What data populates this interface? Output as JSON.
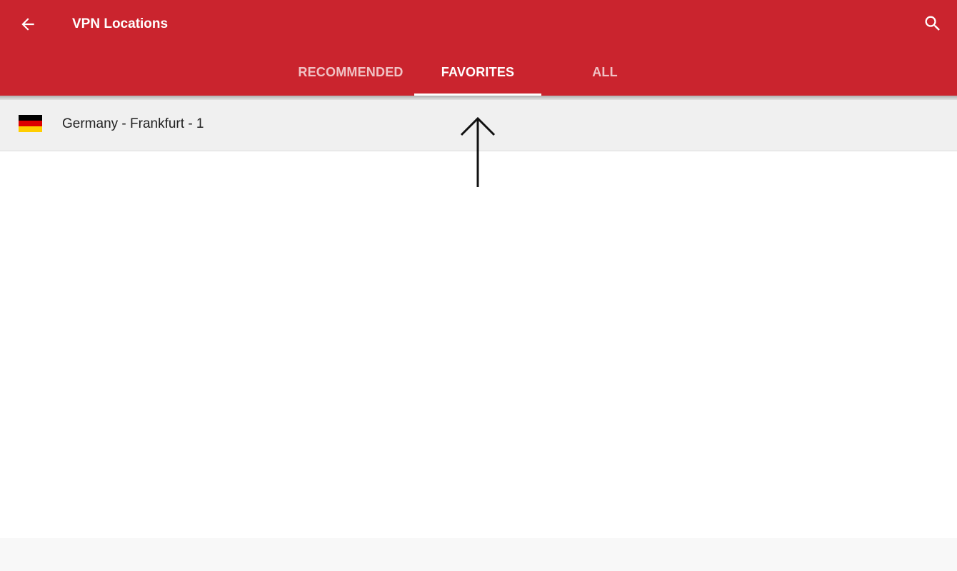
{
  "header": {
    "title": "VPN Locations",
    "back_icon": "arrow-left-icon",
    "search_icon": "search-icon",
    "background_color": "#ca242e"
  },
  "tabs": [
    {
      "label": "RECOMMENDED",
      "active": false
    },
    {
      "label": "FAVORITES",
      "active": true
    },
    {
      "label": "ALL",
      "active": false
    }
  ],
  "favorites": [
    {
      "label": "Germany - Frankfurt - 1",
      "flag_icon": "germany-flag-icon",
      "flag_colors": [
        "#000000",
        "#dd0000",
        "#ffce00"
      ]
    }
  ]
}
